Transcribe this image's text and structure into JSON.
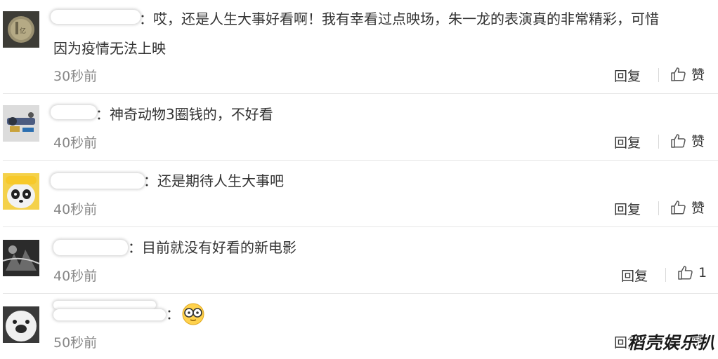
{
  "actions": {
    "reply_label": "回复",
    "like_label": "赞"
  },
  "comments": [
    {
      "text_line1": "：哎，还是人生大事好看啊！我有幸看过点映场，朱一龙的表演真的非常精彩，可惜",
      "text_line2": "因为疫情无法上映",
      "time": "30秒前",
      "like_count": "赞"
    },
    {
      "text_line1": "：神奇动物3圈钱的，不好看",
      "time": "40秒前",
      "like_count": "赞"
    },
    {
      "text_line1": "：还是期待人生大事吧",
      "time": "40秒前",
      "like_count": "赞"
    },
    {
      "text_line1": "：目前就没有好看的新电影",
      "time": "40秒前",
      "like_count": "1"
    },
    {
      "text_line1": "：",
      "emoji": "😳",
      "time": "50秒前",
      "like_count": "赞"
    }
  ],
  "watermark": "稻壳娱乐扒"
}
